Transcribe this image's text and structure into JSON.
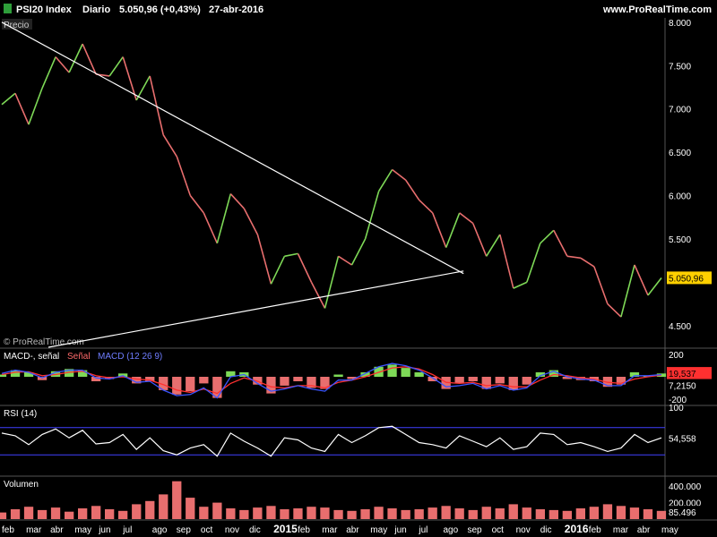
{
  "header": {
    "symbol": "PSI20 Index",
    "period": "Diario",
    "quote": "5.050,96 (+0,43%)",
    "date": "27-abr-2016",
    "site": "www.ProRealTime.com"
  },
  "colors": {
    "background": "#000000",
    "up": "#7ed957",
    "down": "#e86e6e",
    "trendline": "#ffffff",
    "price_badge": "#ffd000",
    "macd_line": "#3b55ff",
    "signal_line": "#ff3030",
    "rsi_band": "#4040ff",
    "volume": "#e86e6e"
  },
  "panels": {
    "price_label": "Precio",
    "watermark": "© ProRealTime.com",
    "macd_label_1": "MACD-, señal",
    "macd_label_2": "Señal",
    "macd_label_3": "MACD (12 26 9)",
    "rsi_label": "RSI (14)",
    "volume_label": "Volumen"
  },
  "chart_data": {
    "type": "line",
    "price": {
      "ylim": [
        4250,
        8050
      ],
      "ticks": [
        "8.000",
        "7.500",
        "7.000",
        "6.500",
        "6.000",
        "5.500",
        "4.500"
      ],
      "tick_values": [
        8000,
        7500,
        7000,
        6500,
        6000,
        5500,
        4500
      ],
      "last_label": "5.050,96",
      "last_value": 5050.96,
      "close": [
        7050,
        7180,
        6820,
        7240,
        7600,
        7420,
        7750,
        7400,
        7380,
        7600,
        7100,
        7380,
        6700,
        6450,
        6000,
        5800,
        5450,
        6020,
        5850,
        5550,
        4980,
        5300,
        5330,
        5000,
        4700,
        5300,
        5200,
        5500,
        6050,
        6300,
        6180,
        5950,
        5800,
        5400,
        5800,
        5680,
        5300,
        5550,
        4930,
        5000,
        5450,
        5600,
        5300,
        5280,
        5180,
        4750,
        4600,
        5200,
        4850,
        5050
      ],
      "trendlines": [
        {
          "x": [
            0,
            47.6
          ],
          "y": [
            8000,
            5100
          ]
        },
        {
          "x": [
            4.8,
            47.6
          ],
          "y": [
            4250,
            5130
          ]
        }
      ]
    },
    "macd": {
      "ylim": [
        -250,
        250
      ],
      "ticks": [
        "200",
        "-200"
      ],
      "tick_values": [
        200,
        -200
      ],
      "value_labels": [
        "19,537",
        "7,2150"
      ],
      "hist": [
        20,
        60,
        40,
        -30,
        50,
        70,
        60,
        -40,
        -20,
        30,
        -60,
        -40,
        -120,
        -160,
        -130,
        -60,
        -190,
        50,
        40,
        -70,
        -150,
        -80,
        -40,
        -100,
        -110,
        20,
        -20,
        40,
        90,
        110,
        80,
        40,
        -40,
        -110,
        -60,
        -40,
        -110,
        -60,
        -120,
        -70,
        40,
        60,
        -20,
        -30,
        -40,
        -90,
        -70,
        40,
        10,
        30
      ],
      "signal": [
        20,
        40,
        45,
        10,
        20,
        40,
        50,
        10,
        -10,
        0,
        -20,
        -30,
        -70,
        -120,
        -140,
        -110,
        -150,
        -60,
        -10,
        -40,
        -90,
        -100,
        -80,
        -80,
        -100,
        -50,
        -30,
        0,
        40,
        80,
        90,
        70,
        20,
        -50,
        -60,
        -50,
        -80,
        -70,
        -90,
        -90,
        -30,
        20,
        10,
        -10,
        -20,
        -50,
        -60,
        -20,
        0,
        15
      ],
      "macd": [
        30,
        60,
        40,
        -10,
        40,
        60,
        60,
        -10,
        -20,
        10,
        -50,
        -40,
        -120,
        -170,
        -160,
        -100,
        -190,
        0,
        20,
        -60,
        -130,
        -110,
        -80,
        -110,
        -130,
        -30,
        -30,
        30,
        90,
        120,
        100,
        60,
        -10,
        -90,
        -80,
        -60,
        -110,
        -80,
        -120,
        -100,
        10,
        50,
        0,
        -20,
        -30,
        -80,
        -80,
        10,
        10,
        20
      ]
    },
    "rsi": {
      "ylim": [
        0,
        100
      ],
      "ticks": [
        "100"
      ],
      "tick_values": [
        100
      ],
      "bands": [
        70,
        30
      ],
      "last_label": "54,558",
      "last_value": 54.558,
      "values": [
        62,
        58,
        45,
        60,
        68,
        55,
        66,
        46,
        48,
        60,
        38,
        55,
        36,
        30,
        40,
        45,
        28,
        62,
        50,
        40,
        28,
        55,
        52,
        40,
        35,
        60,
        48,
        58,
        70,
        72,
        60,
        48,
        45,
        40,
        58,
        50,
        42,
        55,
        38,
        42,
        62,
        60,
        45,
        48,
        42,
        35,
        40,
        60,
        48,
        55
      ]
    },
    "volume": {
      "ylim": [
        0,
        500000
      ],
      "ticks": [
        "400.000",
        "200.000"
      ],
      "tick_values": [
        400000,
        200000
      ],
      "last_label": "85.496",
      "last_value": 85496,
      "values": [
        80000,
        120000,
        150000,
        110000,
        140000,
        90000,
        130000,
        160000,
        120000,
        100000,
        180000,
        220000,
        300000,
        460000,
        260000,
        150000,
        200000,
        130000,
        110000,
        140000,
        160000,
        120000,
        130000,
        150000,
        140000,
        110000,
        100000,
        120000,
        150000,
        130000,
        110000,
        120000,
        140000,
        160000,
        130000,
        110000,
        150000,
        130000,
        180000,
        140000,
        120000,
        110000,
        100000,
        130000,
        150000,
        180000,
        160000,
        140000,
        120000,
        100000
      ]
    },
    "x_months": [
      {
        "x": 0,
        "label": "feb"
      },
      {
        "x": 2.5,
        "label": "mar"
      },
      {
        "x": 5,
        "label": "abr"
      },
      {
        "x": 7.5,
        "label": "may"
      },
      {
        "x": 10,
        "label": "jun"
      },
      {
        "x": 12.5,
        "label": "jul"
      },
      {
        "x": 15.5,
        "label": "ago"
      },
      {
        "x": 18,
        "label": "sep"
      },
      {
        "x": 20.5,
        "label": "oct"
      },
      {
        "x": 23,
        "label": "nov"
      },
      {
        "x": 25.5,
        "label": "dic"
      },
      {
        "x": 28,
        "label": "2015",
        "bold": true
      },
      {
        "x": 30.5,
        "label": "feb"
      },
      {
        "x": 33,
        "label": "mar"
      },
      {
        "x": 35.5,
        "label": "abr"
      },
      {
        "x": 38,
        "label": "may"
      },
      {
        "x": 40.5,
        "label": "jun"
      },
      {
        "x": 43,
        "label": "jul"
      },
      {
        "x": 45.5,
        "label": "ago"
      },
      {
        "x": 48,
        "label": "sep"
      },
      {
        "x": 50.5,
        "label": "oct"
      },
      {
        "x": 53,
        "label": "nov"
      },
      {
        "x": 55.5,
        "label": "dic"
      },
      {
        "x": 58,
        "label": "2016",
        "bold": true
      },
      {
        "x": 60.5,
        "label": "feb"
      },
      {
        "x": 63,
        "label": "mar"
      },
      {
        "x": 65.5,
        "label": "abr"
      },
      {
        "x": 68,
        "label": "may"
      }
    ],
    "x_domain": [
      0,
      68
    ]
  }
}
